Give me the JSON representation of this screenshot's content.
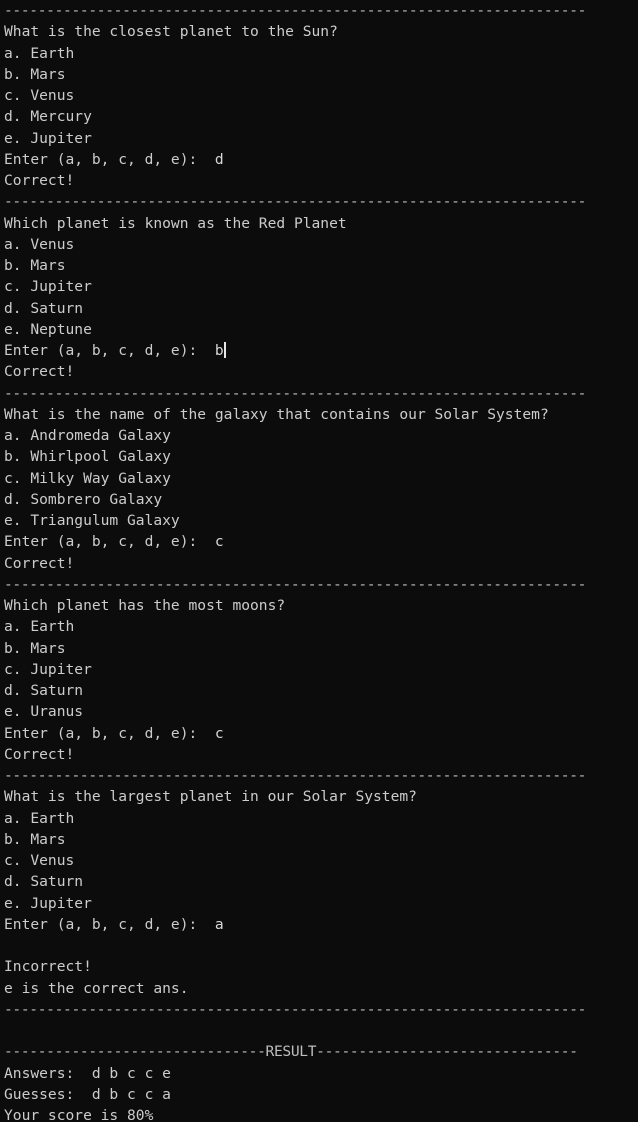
{
  "separator": "---------------------------------------------------------------------",
  "result_separator": "-------------------------------RESULT-------------------------------",
  "prompt": "Enter (a, b, c, d, e):  ",
  "questions": [
    {
      "question": "What is the closest planet to the Sun?",
      "options": [
        "a. Earth",
        "b. Mars",
        "c. Venus",
        "d. Mercury",
        "e. Jupiter"
      ],
      "answer": "d",
      "feedback": [
        "Correct!"
      ]
    },
    {
      "question": "Which planet is known as the Red Planet",
      "options": [
        "a. Venus",
        "b. Mars",
        "c. Jupiter",
        "d. Saturn",
        "e. Neptune"
      ],
      "answer": "b",
      "feedback": [
        "Correct!"
      ]
    },
    {
      "question": "What is the name of the galaxy that contains our Solar System?",
      "options": [
        "a. Andromeda Galaxy",
        "b. Whirlpool Galaxy",
        "c. Milky Way Galaxy",
        "d. Sombrero Galaxy",
        "e. Triangulum Galaxy"
      ],
      "answer": "c",
      "feedback": [
        "Correct!"
      ]
    },
    {
      "question": "Which planet has the most moons?",
      "options": [
        "a. Earth",
        "b. Mars",
        "c. Jupiter",
        "d. Saturn",
        "e. Uranus"
      ],
      "answer": "c",
      "feedback": [
        "Correct!"
      ]
    },
    {
      "question": "What is the largest planet in our Solar System?",
      "options": [
        "a. Earth",
        "b. Mars",
        "c. Venus",
        "d. Saturn",
        "e. Jupiter"
      ],
      "answer": "a",
      "feedback": [
        "",
        "Incorrect!",
        "e is the correct ans."
      ]
    }
  ],
  "result": {
    "answers_line": "Answers:  d b c c e",
    "guesses_line": "Guesses:  d b c c a",
    "score_line": "Your score is 80%"
  }
}
